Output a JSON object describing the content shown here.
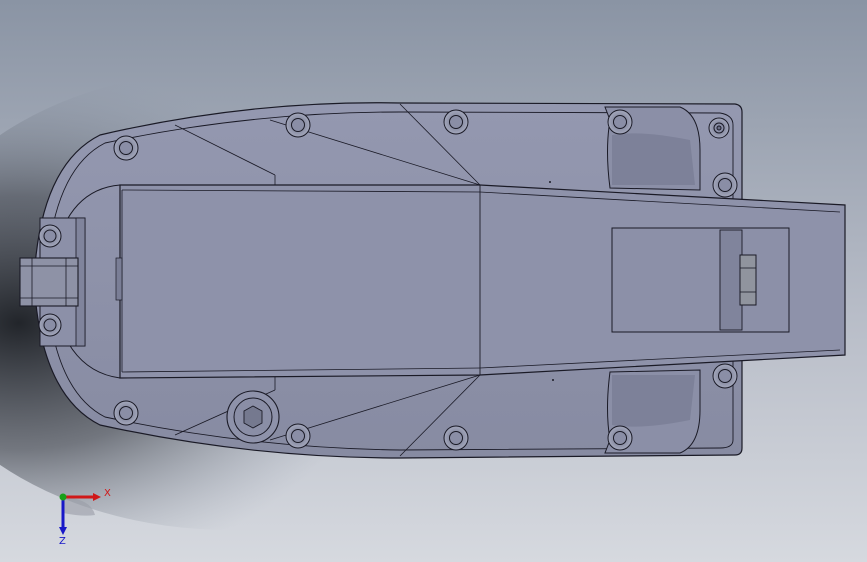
{
  "viewport": {
    "background_top": "#8d97a6",
    "background_bottom": "#d2d5dc",
    "model_fill": "#8c90a8",
    "model_edge": "#1a1a26"
  },
  "triad": {
    "x_label": "X",
    "y_label": "",
    "z_label": "Z",
    "x_color": "#d01818",
    "y_color": "#18a018",
    "z_color": "#1818c8"
  }
}
